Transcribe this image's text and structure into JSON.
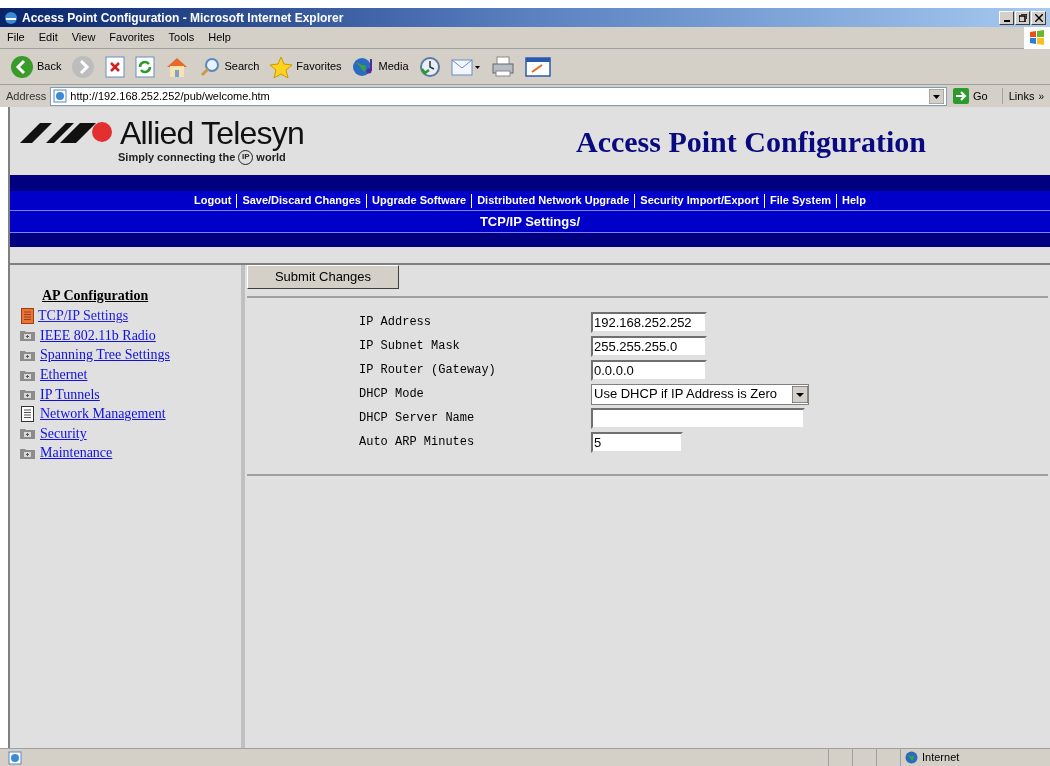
{
  "window": {
    "title": "Access Point Configuration - Microsoft Internet Explorer"
  },
  "menu": [
    "File",
    "Edit",
    "View",
    "Favorites",
    "Tools",
    "Help"
  ],
  "toolbar": [
    {
      "kind": "back",
      "label": "Back"
    },
    {
      "kind": "forward"
    },
    {
      "kind": "stop"
    },
    {
      "kind": "refresh"
    },
    {
      "kind": "home"
    },
    {
      "kind": "search",
      "label": "Search"
    },
    {
      "kind": "favorites",
      "label": "Favorites"
    },
    {
      "kind": "media",
      "label": "Media"
    },
    {
      "kind": "history"
    },
    {
      "kind": "mail"
    },
    {
      "kind": "print"
    },
    {
      "kind": "edit"
    }
  ],
  "address": {
    "label": "Address",
    "url": "http://192.168.252.252/pub/welcome.htm",
    "go": "Go",
    "links": "Links",
    "more": "»"
  },
  "header": {
    "brand": "Allied Telesyn",
    "tagline": "Simply connecting the",
    "tagline_mark": "IP",
    "tagline_end": "world",
    "title": "Access Point Configuration"
  },
  "nav": [
    "Logout",
    "Save/Discard Changes",
    "Upgrade Software",
    "Distributed Network Upgrade",
    "Security Import/Export",
    "File System",
    "Help"
  ],
  "breadcrumb": "TCP/IP Settings/",
  "sidebar": {
    "heading": "AP Configuration",
    "items": [
      {
        "label": "TCP/IP Settings",
        "kind": "page",
        "selected": true
      },
      {
        "label": "IEEE 802.11b Radio",
        "kind": "folder",
        "selected": false
      },
      {
        "label": "Spanning Tree Settings",
        "kind": "folder",
        "selected": false
      },
      {
        "label": "Ethernet",
        "kind": "folder",
        "selected": false
      },
      {
        "label": "IP Tunnels",
        "kind": "folder",
        "selected": false
      },
      {
        "label": "Network Management",
        "kind": "page",
        "selected": false
      },
      {
        "label": "Security",
        "kind": "folder",
        "selected": false
      },
      {
        "label": "Maintenance",
        "kind": "folder",
        "selected": false
      }
    ]
  },
  "form": {
    "submit": "Submit Changes",
    "fields": [
      {
        "label": "IP Address",
        "kind": "text",
        "value": "192.168.252.252"
      },
      {
        "label": "IP Subnet Mask",
        "kind": "text",
        "value": "255.255.255.0"
      },
      {
        "label": "IP Router (Gateway)",
        "kind": "text",
        "value": "0.0.0.0"
      },
      {
        "label": "DHCP Mode",
        "kind": "select",
        "value": "Use DHCP if IP Address is Zero"
      },
      {
        "label": "DHCP Server Name",
        "kind": "text"
      },
      {
        "label": "Auto ARP Minutes",
        "kind": "text",
        "value": "5"
      }
    ]
  },
  "status_bar": {
    "zone": "Internet"
  }
}
